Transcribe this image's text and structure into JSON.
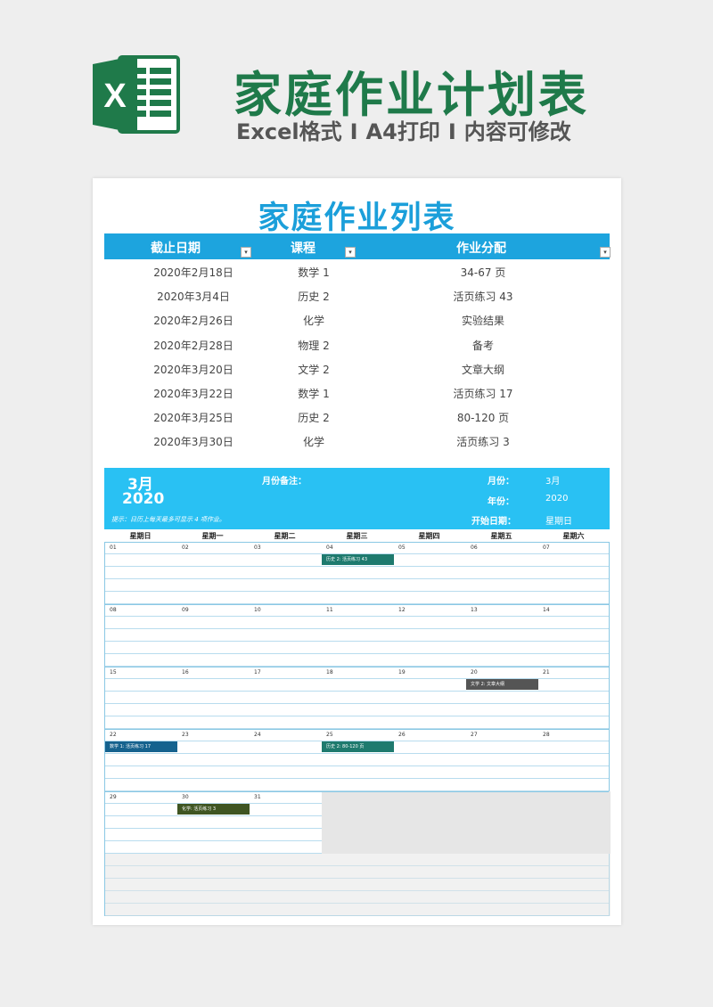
{
  "banner": {
    "title": "家庭作业计划表",
    "sub_format": "Excel格式",
    "sub_print": "A4打印",
    "sub_edit": "内容可修改",
    "separator": "I"
  },
  "logo": {
    "icon": "excel-logo-icon",
    "letter": "X",
    "color": "#1f7a4a"
  },
  "sheet": {
    "title": "家庭作业列表",
    "columns": [
      "截止日期",
      "课程",
      "作业分配"
    ],
    "rows": [
      {
        "date": "2020年2月18日",
        "course": "数学 1",
        "task": "34-67 页"
      },
      {
        "date": "2020年3月4日",
        "course": "历史 2",
        "task": "活页练习 43"
      },
      {
        "date": "2020年2月26日",
        "course": "化学",
        "task": "实验结果"
      },
      {
        "date": "2020年2月28日",
        "course": "物理 2",
        "task": "备考"
      },
      {
        "date": "2020年3月20日",
        "course": "文学 2",
        "task": "文章大纲"
      },
      {
        "date": "2020年3月22日",
        "course": "数学 1",
        "task": "活页练习 17"
      },
      {
        "date": "2020年3月25日",
        "course": "历史 2",
        "task": "80-120 页"
      },
      {
        "date": "2020年3月30日",
        "course": "化学",
        "task": "活页练习 3"
      }
    ]
  },
  "calendar": {
    "month": "3月",
    "year": "2020",
    "month_note_label": "月份备注：",
    "tip": "提示：日历上每天最多可显示 4 项作业。",
    "month_label": "月份：",
    "month_value": "3月",
    "year_label": "年份：",
    "year_value": "2020",
    "start_label": "开始日期：",
    "start_value": "星期日",
    "weekdays": [
      "星期日",
      "星期一",
      "星期二",
      "星期三",
      "星期四",
      "星期五",
      "星期六"
    ],
    "weeks": [
      [
        "01",
        "02",
        "03",
        "04",
        "05",
        "06",
        "07"
      ],
      [
        "08",
        "09",
        "10",
        "11",
        "12",
        "13",
        "14"
      ],
      [
        "15",
        "16",
        "17",
        "18",
        "19",
        "20",
        "21"
      ],
      [
        "22",
        "23",
        "24",
        "25",
        "26",
        "27",
        "28"
      ],
      [
        "29",
        "30",
        "31"
      ]
    ],
    "events": [
      {
        "week": 0,
        "day": 3,
        "text": "历史 2: 活页练习 43",
        "color": "#1e7a6e"
      },
      {
        "week": 2,
        "day": 5,
        "text": "文学 2: 文章大纲",
        "color": "#555555"
      },
      {
        "week": 3,
        "day": 0,
        "text": "数学 1: 活页练习 17",
        "color": "#15628e"
      },
      {
        "week": 3,
        "day": 3,
        "text": "历史 2: 80-120 页",
        "color": "#1e7a6e"
      },
      {
        "week": 4,
        "day": 1,
        "text": "化学: 活页练习 3",
        "color": "#3f5522"
      }
    ]
  },
  "colors": {
    "accent": "#1da4de",
    "calendar_header": "#29c1f3",
    "title_green": "#1f7a4a"
  }
}
